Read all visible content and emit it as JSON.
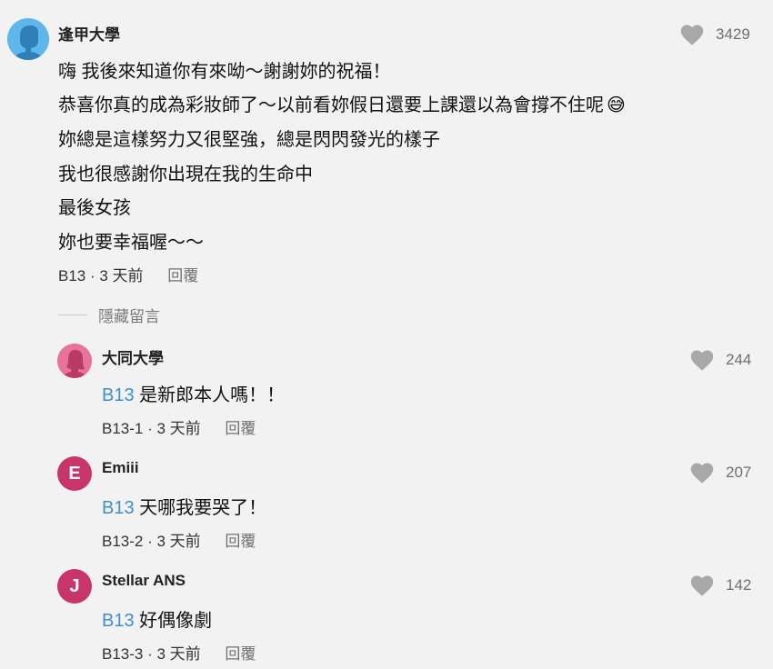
{
  "top_comment": {
    "author": "逢甲大學",
    "likes": "3429",
    "lines": [
      "嗨 我後來知道你有來呦～謝謝妳的祝福！",
      "恭喜你真的成為彩妝師了～以前看妳假日還要上課還以為會撐不住呢",
      "妳總是這樣努力又很堅強，總是閃閃發光的樣子",
      "我也很感謝你出現在我的生命中",
      "最後女孩",
      "妳也要幸福喔～～"
    ],
    "emoji": "😅",
    "floor": "B13",
    "time": "3 天前",
    "reply_label": "回覆"
  },
  "hide_label": "隱藏留言",
  "replies": [
    {
      "author": "大同大學",
      "tag": "B13",
      "text": "是新郎本人嗎！！",
      "floor": "B13-1",
      "time": "3 天前",
      "reply_label": "回覆",
      "likes": "244",
      "avatar_color": "#e8739a",
      "avatar_icon": "female-avatar-icon"
    },
    {
      "author": "Emiii",
      "initial": "E",
      "tag": "B13",
      "text": "天哪我要哭了！",
      "floor": "B13-2",
      "time": "3 天前",
      "reply_label": "回覆",
      "likes": "207",
      "avatar_color": "#c8356a"
    },
    {
      "author": "Stellar ANS",
      "initial": "J",
      "tag": "B13",
      "text": "好偶像劇",
      "floor": "B13-3",
      "time": "3 天前",
      "reply_label": "回覆",
      "likes": "142",
      "avatar_color": "#c8356a"
    }
  ],
  "colors": {
    "accent_tag": "#3d8fd4",
    "heart": "#a8a8a8",
    "background": "#f2f2f2"
  }
}
